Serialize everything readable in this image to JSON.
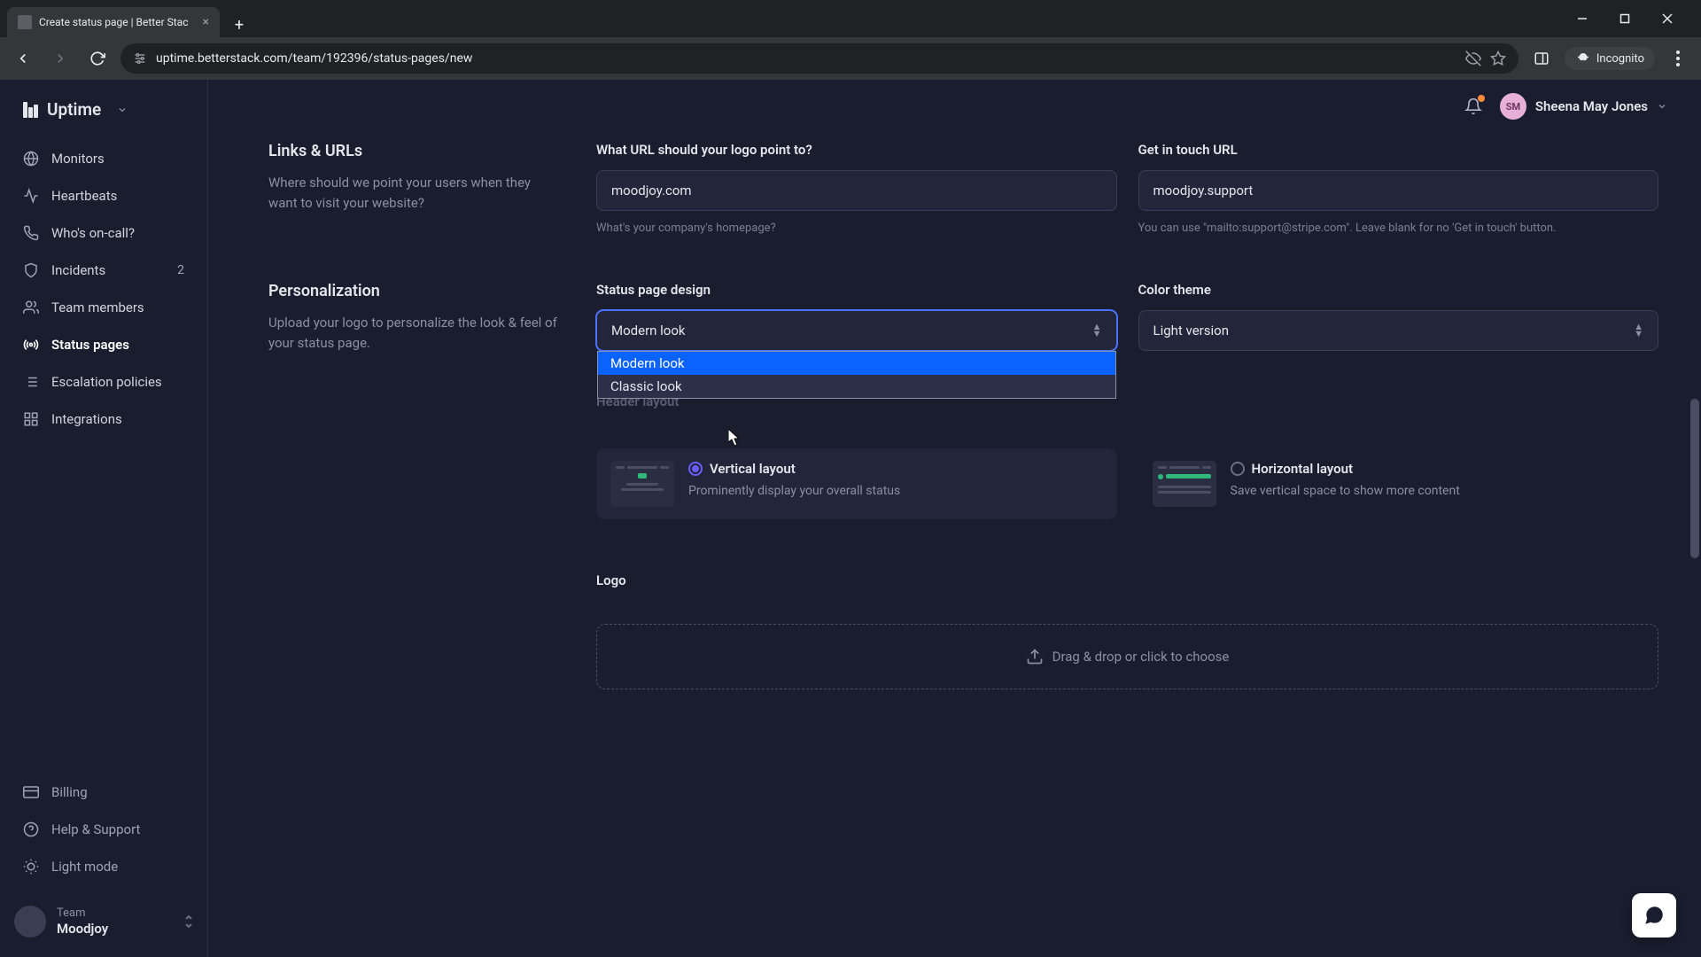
{
  "browser": {
    "tab_title": "Create status page | Better Stac",
    "url": "uptime.betterstack.com/team/192396/status-pages/new",
    "incognito_label": "Incognito"
  },
  "brand": {
    "name": "Uptime"
  },
  "nav": {
    "monitors": "Monitors",
    "heartbeats": "Heartbeats",
    "oncall": "Who's on-call?",
    "incidents": "Incidents",
    "incidents_badge": "2",
    "team_members": "Team members",
    "status_pages": "Status pages",
    "escalation": "Escalation policies",
    "integrations": "Integrations",
    "billing": "Billing",
    "help": "Help & Support",
    "light_mode": "Light mode"
  },
  "team": {
    "label": "Team",
    "name": "Moodjoy"
  },
  "user": {
    "initials": "SM",
    "name": "Sheena May Jones"
  },
  "sections": {
    "links": {
      "title": "Links & URLs",
      "desc": "Where should we point your users when they want to visit your website?",
      "logo_url_label": "What URL should your logo point to?",
      "logo_url_value": "moodjoy.com",
      "logo_url_hint": "What's your company's homepage?",
      "contact_label": "Get in touch URL",
      "contact_value": "moodjoy.support",
      "contact_hint": "You can use \"mailto:support@stripe.com\". Leave blank for no 'Get in touch' button."
    },
    "personalization": {
      "title": "Personalization",
      "desc": "Upload your logo to personalize the look & feel of your status page.",
      "design_label": "Status page design",
      "design_value": "Modern look",
      "design_options": {
        "modern": "Modern look",
        "classic": "Classic look"
      },
      "theme_label": "Color theme",
      "theme_value": "Light version",
      "header_layout_label": "Header layout",
      "vertical": {
        "name": "Vertical layout",
        "desc": "Prominently display your overall status"
      },
      "horizontal": {
        "name": "Horizontal layout",
        "desc": "Save vertical space to show more content"
      },
      "logo_label": "Logo",
      "dropzone": "Drag & drop or click to choose"
    }
  }
}
